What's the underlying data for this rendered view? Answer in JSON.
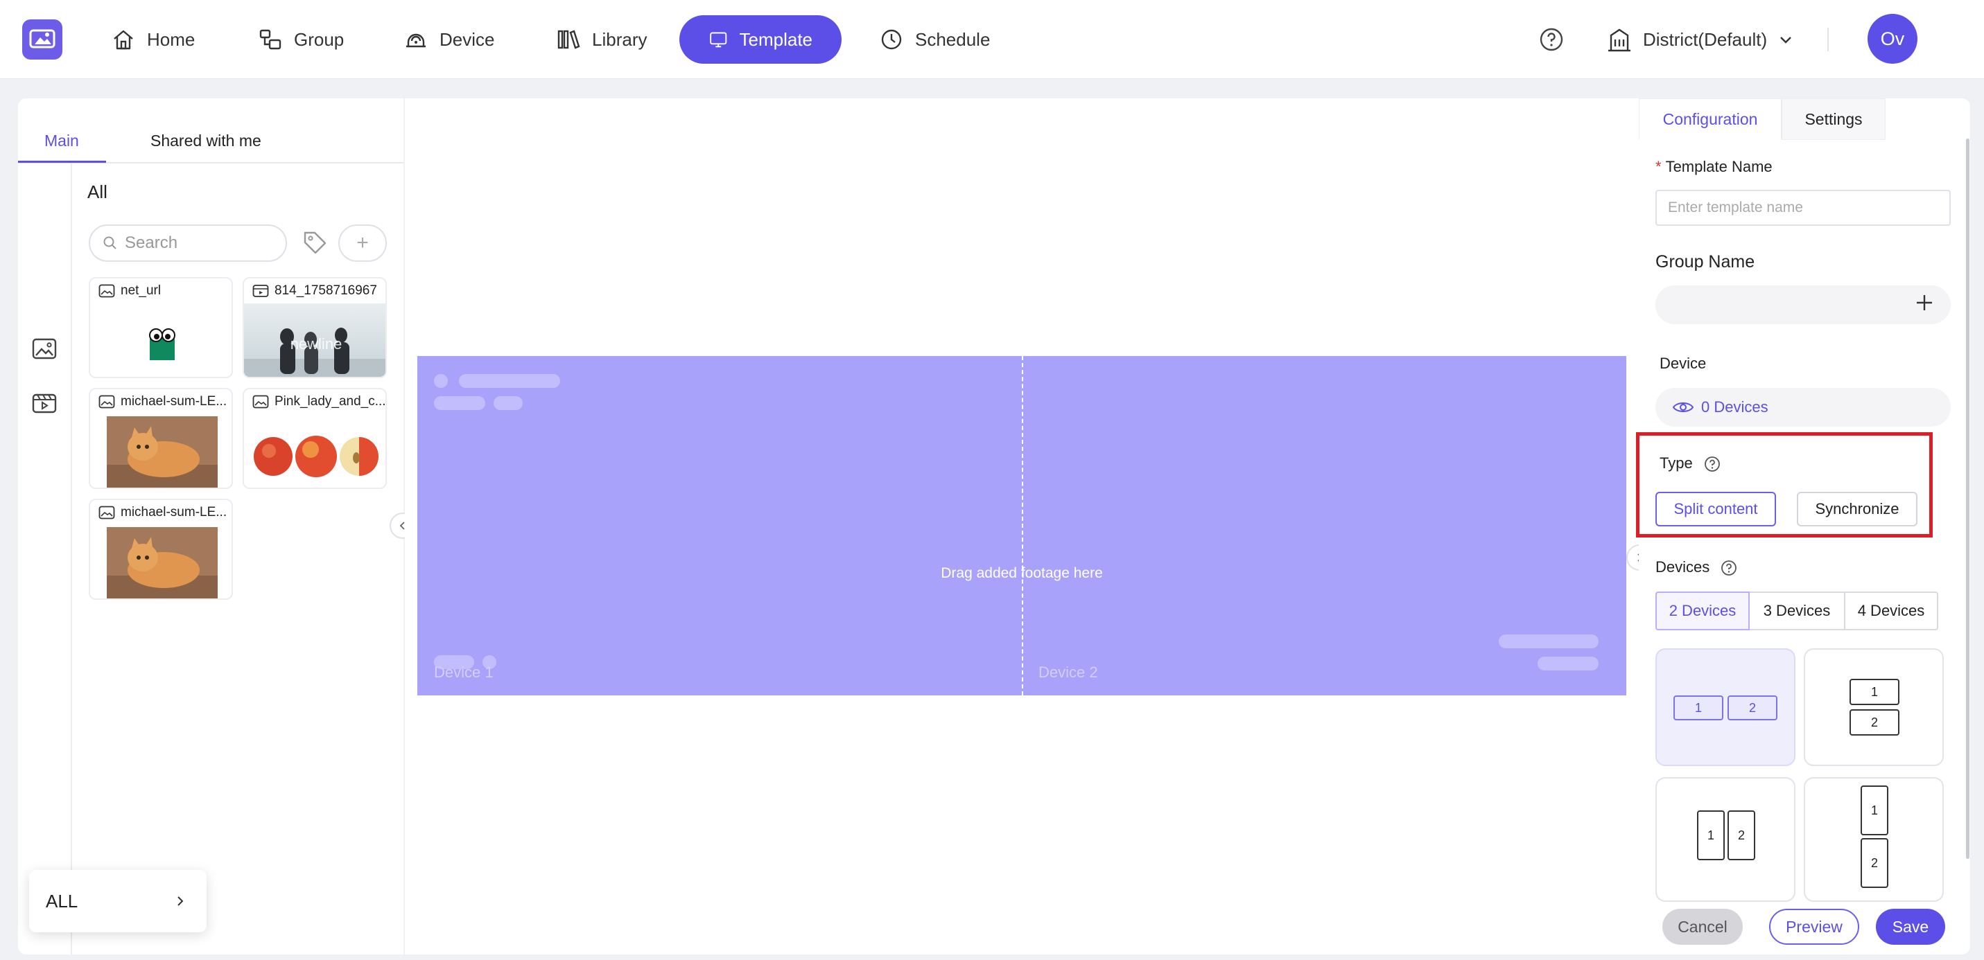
{
  "nav": {
    "items": [
      {
        "label": "Home",
        "icon": "home-icon"
      },
      {
        "label": "Group",
        "icon": "group-icon"
      },
      {
        "label": "Device",
        "icon": "device-icon"
      },
      {
        "label": "Library",
        "icon": "library-icon"
      },
      {
        "label": "Template",
        "icon": "template-icon",
        "active": true
      },
      {
        "label": "Schedule",
        "icon": "clock-icon"
      }
    ],
    "district": "District(Default)",
    "avatar": "Ov",
    "accent_color": "#5b4fe8"
  },
  "library": {
    "tabs": [
      "Main",
      "Shared with me"
    ],
    "title": "All",
    "search_placeholder": "Search",
    "add_label": "+",
    "items": [
      {
        "name": "net_url",
        "kind": "image"
      },
      {
        "name": "814_1758716967",
        "kind": "video",
        "overlay_text": "newline"
      },
      {
        "name": "michael-sum-LE...",
        "kind": "image"
      },
      {
        "name": "Pink_lady_and_c...",
        "kind": "image"
      },
      {
        "name": "michael-sum-LE...",
        "kind": "image"
      }
    ],
    "filter_label": "ALL"
  },
  "canvas": {
    "device1_label": "Device 1",
    "device2_label": "Device 2",
    "drop_hint": "Drag added footage here",
    "stage_color": "#a8a2fa"
  },
  "config": {
    "tabs": [
      "Configuration",
      "Settings"
    ],
    "template_name_label": "Template Name",
    "template_name_placeholder": "Enter template name",
    "group_name_label": "Group Name",
    "device_label": "Device",
    "devices_count": "0 Devices",
    "type_label": "Type",
    "type_options": [
      "Split content",
      "Synchronize"
    ],
    "devices_label": "Devices",
    "device_options": [
      "2 Devices",
      "3 Devices",
      "4 Devices"
    ],
    "layout_numbers": [
      "1",
      "2"
    ],
    "cancel_label": "Cancel",
    "preview_label": "Preview",
    "save_label": "Save"
  }
}
